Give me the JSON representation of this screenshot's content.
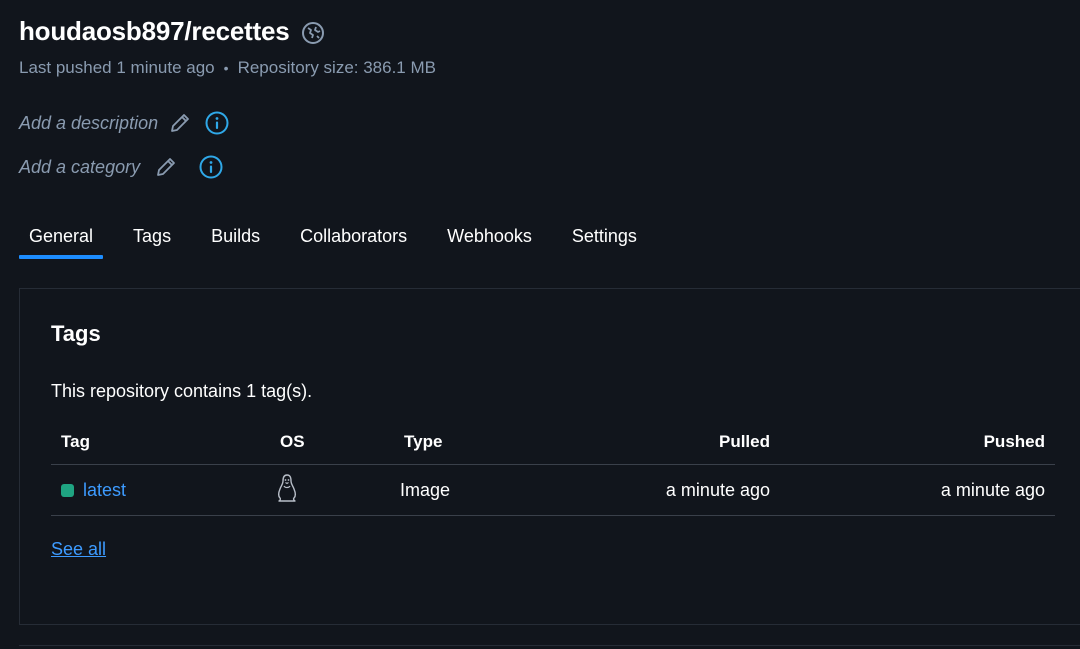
{
  "repo": {
    "name": "houdaosb897/recettes",
    "last_pushed": "Last pushed 1 minute ago",
    "separator": "•",
    "size": "Repository size: 386.1 MB",
    "description_placeholder": "Add a description",
    "category_placeholder": "Add a category",
    "visibility_icon": "globe-icon"
  },
  "tabs": [
    {
      "label": "General",
      "active": true
    },
    {
      "label": "Tags"
    },
    {
      "label": "Builds"
    },
    {
      "label": "Collaborators"
    },
    {
      "label": "Webhooks"
    },
    {
      "label": "Settings"
    }
  ],
  "tags_panel": {
    "title": "Tags",
    "description": "This repository contains 1 tag(s).",
    "columns": {
      "tag": "Tag",
      "os": "OS",
      "type": "Type",
      "pulled": "Pulled",
      "pushed": "Pushed"
    },
    "rows": [
      {
        "tag": "latest",
        "os_icon": "linux-penguin-icon",
        "type": "Image",
        "pulled": "a minute ago",
        "pushed": "a minute ago",
        "status_color": "#1fa482"
      }
    ],
    "see_all": "See all"
  },
  "colors": {
    "background": "#11151c",
    "accent": "#1d8dff",
    "link": "#3d9bff",
    "muted_text": "#8a9bb0",
    "info_icon": "#2fa8e8"
  }
}
